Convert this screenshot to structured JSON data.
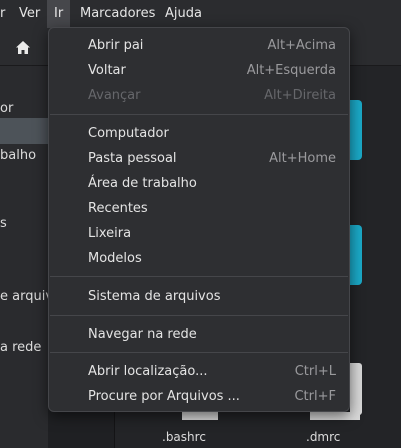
{
  "menubar": {
    "items": [
      {
        "label": "r"
      },
      {
        "label": "Ver"
      },
      {
        "label": "Ir"
      },
      {
        "label": "Marcadores"
      },
      {
        "label": "Ajuda"
      }
    ]
  },
  "sidebar": {
    "labels": [
      "or",
      "balho",
      "s",
      "e arquivo",
      "a rede"
    ]
  },
  "files": [
    {
      "name": ".bashrc"
    },
    {
      "name": ".dmrc"
    }
  ],
  "menu": {
    "items": [
      {
        "label": "Abrir pai",
        "accel": "Alt+Acima",
        "enabled": true
      },
      {
        "label": "Voltar",
        "accel": "Alt+Esquerda",
        "enabled": true
      },
      {
        "label": "Avançar",
        "accel": "Alt+Direita",
        "enabled": false
      },
      {
        "label": "Computador",
        "accel": "",
        "enabled": true
      },
      {
        "label": "Pasta pessoal",
        "accel": "Alt+Home",
        "enabled": true
      },
      {
        "label": "Área de trabalho",
        "accel": "",
        "enabled": true
      },
      {
        "label": "Recentes",
        "accel": "",
        "enabled": true
      },
      {
        "label": "Lixeira",
        "accel": "",
        "enabled": true
      },
      {
        "label": "Modelos",
        "accel": "",
        "enabled": true
      },
      {
        "label": "Sistema de arquivos",
        "accel": "",
        "enabled": true
      },
      {
        "label": "Navegar na rede",
        "accel": "",
        "enabled": true
      },
      {
        "label": "Abrir localização...",
        "accel": "Ctrl+L",
        "enabled": true
      },
      {
        "label": "Procure por Arquivos ...",
        "accel": "Ctrl+F",
        "enabled": true
      }
    ]
  },
  "colors": {
    "menu_bg": "#2e2f32",
    "accent_folder": "#1ba9c7",
    "disabled_text": "#66676b"
  }
}
